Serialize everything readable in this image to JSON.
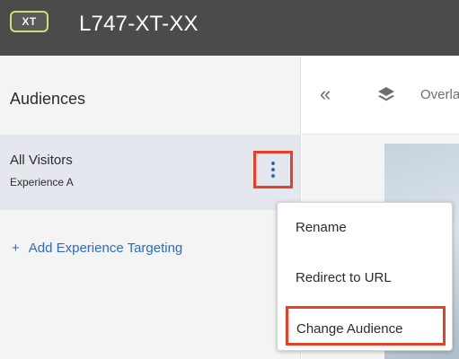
{
  "header": {
    "badge": "XT",
    "title": "L747-XT-XX"
  },
  "sidebar": {
    "heading": "Audiences",
    "audience": {
      "name": "All Visitors",
      "experience": "Experience A"
    },
    "add_link": {
      "icon": "+",
      "label": "Add Experience Targeting"
    }
  },
  "toolbar": {
    "collapse_icon": "«",
    "layers_icon": "layers-icon",
    "overlay_label": "Overlay"
  },
  "context_menu": {
    "items": [
      "Rename",
      "Redirect to URL",
      "Change Audience"
    ]
  },
  "colors": {
    "header_bg": "#4b4b4b",
    "accent_blue": "#2b6cc4",
    "highlight_red": "#e54128",
    "badge_border": "#d6d97c"
  }
}
